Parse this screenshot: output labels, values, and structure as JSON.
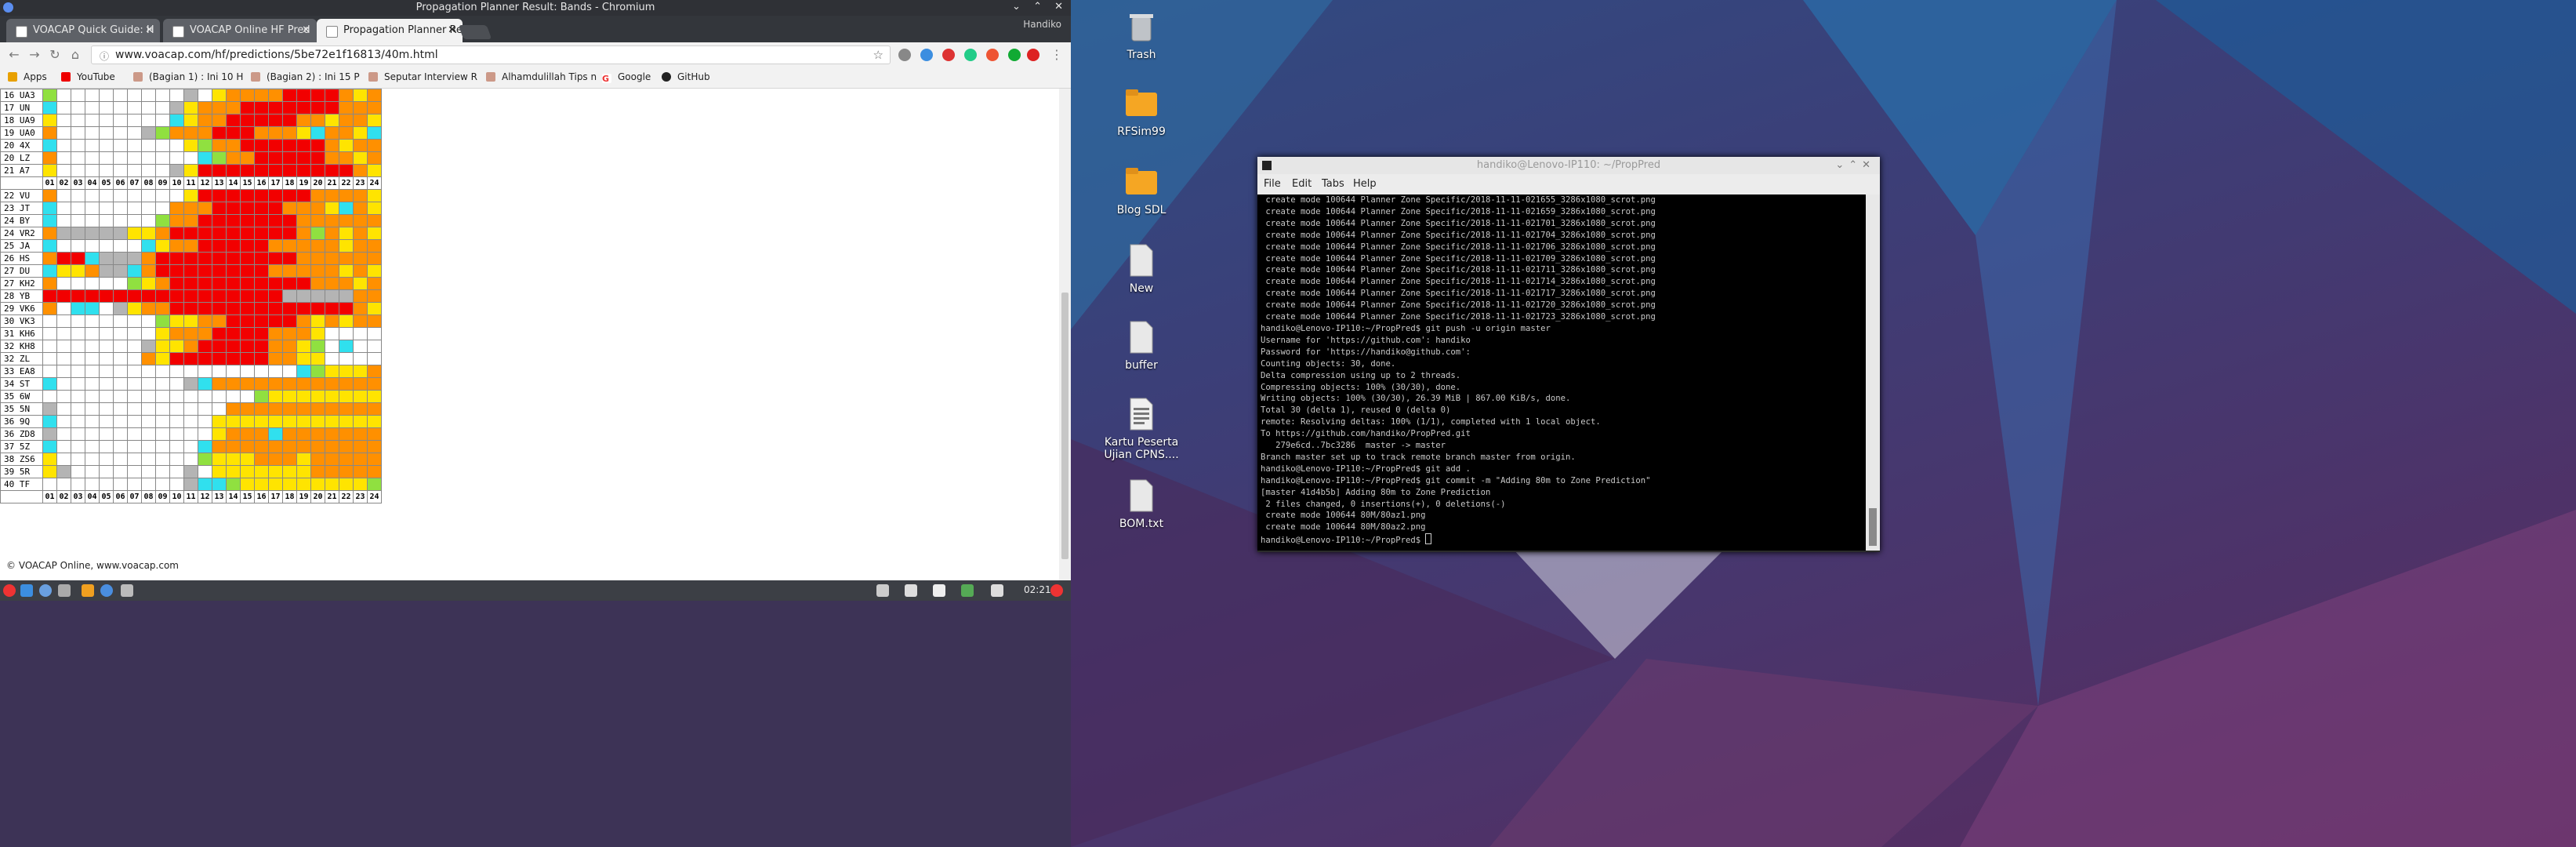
{
  "browser": {
    "window_title": "Propagation Planner Result: Bands - Chromium",
    "user": "Handiko",
    "tabs": [
      {
        "label": "VOACAP Quick Guide: H",
        "active": false
      },
      {
        "label": "VOACAP Online HF Pred",
        "active": false
      },
      {
        "label": "Propagation Planner Res",
        "active": true
      }
    ],
    "url": "www.voacap.com/hf/predictions/5be72e1f16813/40m.html",
    "bookmarks": [
      "Apps",
      "YouTube",
      "(Bagian 1) : Ini 10 H",
      "(Bagian 2) : Ini 15 P",
      "Seputar Interview R",
      "Alhamdulillah Tips n",
      "Google",
      "GitHub"
    ]
  },
  "prediction": {
    "hours": [
      "01",
      "02",
      "03",
      "04",
      "05",
      "06",
      "07",
      "08",
      "09",
      "10",
      "11",
      "12",
      "13",
      "14",
      "15",
      "16",
      "17",
      "18",
      "19",
      "20",
      "21",
      "22",
      "23",
      "24"
    ],
    "group1": [
      {
        "zone": "16 UA3",
        "cells": "GWWWWWWWWWLWYOOOORRRROYO"
      },
      {
        "zone": "17 UN",
        "cells": "CWWWWWWWWLYOOORRRRRRROOO"
      },
      {
        "zone": "18 UA9",
        "cells": "YWWWWWWWWCYOORRRRROOYOOY"
      },
      {
        "zone": "19 UA0",
        "cells": "OWWWWWWLGOOORRROOOYCOOYC"
      },
      {
        "zone": "20 4X",
        "cells": "CWWWWWWWWWYGOORRRRRROYOO"
      },
      {
        "zone": "20 LZ",
        "cells": "OWWWWWWWWWWCGOORRRRROOYO"
      },
      {
        "zone": "21 A7",
        "cells": "YWWWWWWWWLYRRRRRRRRRRROY"
      }
    ],
    "group2": [
      {
        "zone": "22 VU",
        "cells": "OWWWWWWWWWYRRRRRRRROOOOY"
      },
      {
        "zone": "23 JT",
        "cells": "CWWWWWWWWOOORRRRROOOYCOY"
      },
      {
        "zone": "24 BY",
        "cells": "CWWWWWWWGOORRRRRRROOOOOO"
      },
      {
        "zone": "24 VR2",
        "cells": "OLLLLLYYORRRRRRRRROGOYOY"
      },
      {
        "zone": "25 JA",
        "cells": "CWWWWWWCYOORRRRROOOOOYOO"
      },
      {
        "zone": "26 HS",
        "cells": "ORRCLLLORRRRRRRRRROOOOOO"
      },
      {
        "zone": "27 DU",
        "cells": "CYYOLLCORRRRRRRROOOOOYOY"
      },
      {
        "zone": "27 KH2",
        "cells": "OWWWWWGYORRRRRRRRRROOOYO"
      },
      {
        "zone": "28 YB",
        "cells": "RRRRRRRRRRRRRRRRRLLLLLOO"
      },
      {
        "zone": "29 VK6",
        "cells": "OWCCWLYOORRRRRRRRRRRRROY"
      },
      {
        "zone": "30 VK3",
        "cells": "WWWWWWWWGYYOORRRRROYOYOO"
      },
      {
        "zone": "31 KH6",
        "cells": "WWWWWWWWYOOORRRROOOYWWWW"
      },
      {
        "zone": "32 KH8",
        "cells": "WWWWWWWLYYORRRRROOYGWCWW"
      },
      {
        "zone": "32 ZL",
        "cells": "WWWWWWWOYRRRRRRROOYYWWWW"
      },
      {
        "zone": "33 EA8",
        "cells": "WWWWWWWWWWWWWWWWWWCGYYYO"
      },
      {
        "zone": "34 ST",
        "cells": "CWWWWWWWWWLCOOOOOOOOOOOO"
      },
      {
        "zone": "35 6W",
        "cells": "WWWWWWWWWWWWWWWGYYYYYYYY"
      },
      {
        "zone": "35 5N",
        "cells": "LWWWWWWWWWWWWOOOOOOOOOOO"
      },
      {
        "zone": "36 9Q",
        "cells": "CWWWWWWWWWWWYYYYYYYYYYYY"
      },
      {
        "zone": "36 ZD8",
        "cells": "LWWWWWWWWWWWYOOOCOOOOOOO"
      },
      {
        "zone": "37 5Z",
        "cells": "CWWWWWWWWWWCOOOOOOOOOOOO"
      },
      {
        "zone": "38 ZS6",
        "cells": "YWWWWWWWWWWGYYYOOOYOOOOO"
      },
      {
        "zone": "39 5R",
        "cells": "YLWWWWWWWWLWYYYYYYYOOOOO"
      },
      {
        "zone": "40 TF",
        "cells": "WWWWWWWWWWLCCGYYYYYYYYYG"
      }
    ],
    "cell_colors": {
      "W": "#ffffff",
      "L": "#b4b4b4",
      "C": "#30e0ee",
      "G": "#90e040",
      "Y": "#ffe400",
      "O": "#ff9000",
      "R": "#f20000"
    },
    "footer": "© VOACAP Online, www.voacap.com"
  },
  "panel": {
    "clock": "02:21"
  },
  "desktop_icons": [
    "Trash",
    "RFSim99",
    "Blog SDL",
    "New",
    "buffer",
    "Kartu Peserta Ujian CPNS....",
    "BOM.txt"
  ],
  "terminal": {
    "title": "handiko@Lenovo-IP110: ~/PropPred",
    "menu": [
      "File",
      "Edit",
      "Tabs",
      "Help"
    ],
    "lines": [
      " create mode 100644 Planner Zone Specific/2018-11-11-021655_3286x1080_scrot.png",
      " create mode 100644 Planner Zone Specific/2018-11-11-021659_3286x1080_scrot.png",
      " create mode 100644 Planner Zone Specific/2018-11-11-021701_3286x1080_scrot.png",
      " create mode 100644 Planner Zone Specific/2018-11-11-021704_3286x1080_scrot.png",
      " create mode 100644 Planner Zone Specific/2018-11-11-021706_3286x1080_scrot.png",
      " create mode 100644 Planner Zone Specific/2018-11-11-021709_3286x1080_scrot.png",
      " create mode 100644 Planner Zone Specific/2018-11-11-021711_3286x1080_scrot.png",
      " create mode 100644 Planner Zone Specific/2018-11-11-021714_3286x1080_scrot.png",
      " create mode 100644 Planner Zone Specific/2018-11-11-021717_3286x1080_scrot.png",
      " create mode 100644 Planner Zone Specific/2018-11-11-021720_3286x1080_scrot.png",
      " create mode 100644 Planner Zone Specific/2018-11-11-021723_3286x1080_scrot.png",
      "handiko@Lenovo-IP110:~/PropPred$ git push -u origin master",
      "Username for 'https://github.com': handiko",
      "Password for 'https://handiko@github.com':",
      "Counting objects: 30, done.",
      "Delta compression using up to 2 threads.",
      "Compressing objects: 100% (30/30), done.",
      "Writing objects: 100% (30/30), 26.39 MiB | 867.00 KiB/s, done.",
      "Total 30 (delta 1), reused 0 (delta 0)",
      "remote: Resolving deltas: 100% (1/1), completed with 1 local object.",
      "To https://github.com/handiko/PropPred.git",
      "   279e6cd..7bc3286  master -> master",
      "Branch master set up to track remote branch master from origin.",
      "handiko@Lenovo-IP110:~/PropPred$ git add .",
      "handiko@Lenovo-IP110:~/PropPred$ git commit -m \"Adding 80m to Zone Prediction\"",
      "[master 41d4b5b] Adding 80m to Zone Prediction",
      " 2 files changed, 0 insertions(+), 0 deletions(-)",
      " create mode 100644 80M/80az1.png",
      " create mode 100644 80M/80az2.png",
      "handiko@Lenovo-IP110:~/PropPred$ "
    ]
  }
}
